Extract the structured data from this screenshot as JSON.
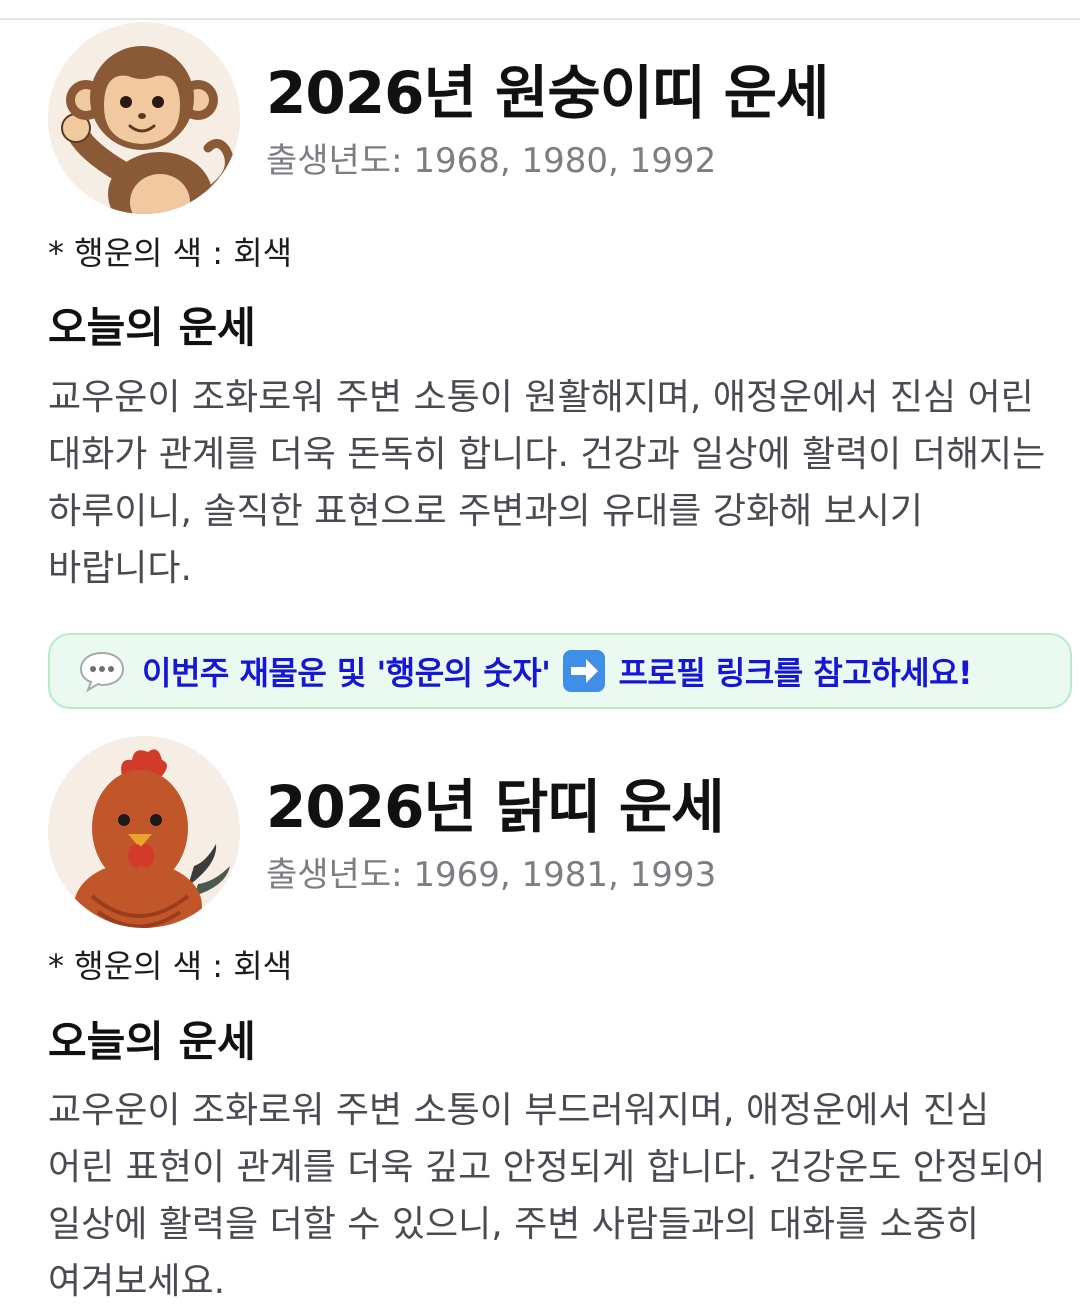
{
  "sections": [
    {
      "animal_icon": "monkey-icon",
      "title": "2026년 원숭이띠 운세",
      "birth_years": "출생년도: 1968, 1980, 1992",
      "lucky_color": "* 행운의 색 : 회색",
      "fortune_heading": "오늘의 운세",
      "fortune_text": "교우운이 조화로워 주변 소통이 원활해지며, 애정운에서 진심 어린 대화가 관계를 더욱 돈독히 합니다. 건강과 일상에 활력이 더해지는 하루이니, 솔직한 표현으로 주변과의 유대를 강화해 보시기 바랍니다."
    },
    {
      "animal_icon": "rooster-icon",
      "title": "2026년 닭띠 운세",
      "birth_years": "출생년도: 1969, 1981, 1993",
      "lucky_color": "* 행운의 색 : 회색",
      "fortune_heading": "오늘의 운세",
      "fortune_text": "교우운이 조화로워 주변 소통이 부드러워지며, 애정운에서 진심 어린 표현이 관계를 더욱 깊고 안정되게 합니다. 건강운도 안정되어 일상에 활력을 더할 수 있으니, 주변 사람들과의 대화를 소중히 여겨보세요."
    }
  ],
  "promo": {
    "icon": "speech-bubble-icon",
    "text_before_arrow": "이번주 재물운 및 '행운의 숫자'",
    "arrow_icon": "right-arrow-icon",
    "text_after_arrow": "프로필 링크를 참고하세요!",
    "text_color": "#1616d6",
    "background_color": "#eafaf0",
    "border_color": "#b9ecc6"
  }
}
